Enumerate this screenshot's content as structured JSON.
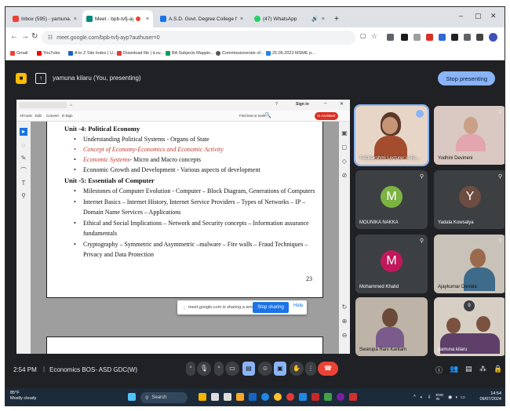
{
  "browser": {
    "tabs": [
      {
        "label": "Inbox (595) - yamuna.kilaru@c",
        "color": "#ea4335"
      },
      {
        "label": "Meet - bpb-tvfj-ayp",
        "color": "#00897b",
        "active": true
      },
      {
        "label": "A.S.D. Govt. Degree College fo",
        "color": "#1a73e8"
      },
      {
        "label": "(47) WhatsApp",
        "color": "#25d366"
      }
    ],
    "new_tab": "+",
    "url": "meet.google.com/bpb-tvfj-ayp?authuser=0",
    "bookmarks": [
      "Gmail",
      "YouTube",
      "A to Z Site Index | U...",
      "Download file | iLov...",
      "BA Subjects Mappin...",
      "Commissionerate of...",
      "25.06.2023 MSME p..."
    ]
  },
  "meet": {
    "presenter_text": "yamuna kilaru (You, presenting)",
    "stop_presenting": "Stop presenting",
    "shared_window": {
      "sign_in": "Sign in",
      "find": "Find text or tools",
      "toolbar": [
        "All tools",
        "Edit",
        "Convert",
        "E-Sign"
      ],
      "ai_assistant": "AI Assistant",
      "doc": {
        "unit4_title": "Unit -4: Political Economy",
        "unit4_items": [
          {
            "text": "Understanding Political Systems - Organs of State",
            "red": false
          },
          {
            "text": "Concept of Economy-Economics and Economic Activity",
            "red": true
          },
          {
            "text": "Economic Systems- Micro and Macro concepts",
            "red": "partial"
          },
          {
            "text": "Economic Growth and Development - Various aspects of development",
            "red": false
          }
        ],
        "unit5_title": "Unit -5: Essentials of Computer",
        "unit5_lines": [
          "Milestones of Computer Evolution - Computer – Block Diagram, Generations of Computers",
          "Internet Basics – Internet History, Internet Service Providers – Types of Networks – IP –",
          "Domain Name Services – Applications",
          "Ethical and Social Implications – Network and Security concepts – Information assurance",
          "fundamentals",
          "Cryptography – Symmetric and Asymmetric –malware – Fire walls – Fraud Techniques –",
          "Privacy and Data Protection"
        ],
        "econ_systems_red": "Economic Systems",
        "econ_systems_rest": "- Micro and Macro concepts",
        "page_number": "23"
      }
    },
    "share_notice": "meet.google.com is sharing a window.",
    "stop_sharing": "Stop sharing",
    "hide": "Hide",
    "participants": [
      {
        "name": "T.Adilakshmi Lecturer in Ec...",
        "type": "video",
        "speaking": true
      },
      {
        "name": "Yodhini Devineni",
        "type": "video"
      },
      {
        "name": "MOUNIKA NAKKA",
        "type": "avatar",
        "initial": "M",
        "color": "#7cb342"
      },
      {
        "name": "Yadala Kowsalya",
        "type": "avatar",
        "initial": "Y",
        "color": "#6d4c41"
      },
      {
        "name": "Mohammed Khalid",
        "type": "avatar",
        "initial": "M",
        "color": "#c2185b"
      },
      {
        "name": "Ajaykumar Divvala",
        "type": "video"
      },
      {
        "name": "Swarupa Rani Kantam",
        "type": "video"
      },
      {
        "name": "yamuna kilaru",
        "type": "video"
      }
    ],
    "others_count": "9",
    "time": "2:54 PM",
    "meeting_title": "Economics BOS- ASD GDC(W)"
  },
  "taskbar": {
    "temp": "85°F",
    "weather": "Mostly cloudy",
    "search": "Search",
    "lang": "ENG",
    "region": "IN",
    "time": "14:54",
    "date": "09/07/2024"
  }
}
